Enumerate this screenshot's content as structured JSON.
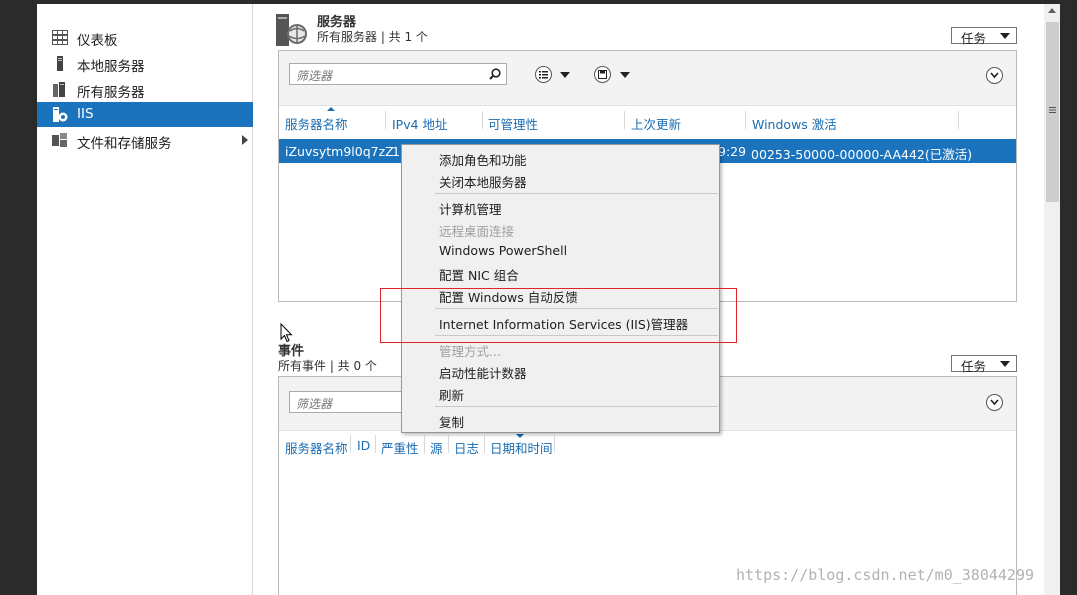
{
  "sidebar": {
    "items": [
      {
        "label": "仪表板",
        "icon": "dashboard-icon",
        "active": false
      },
      {
        "label": "本地服务器",
        "icon": "local-server-icon",
        "active": false
      },
      {
        "label": "所有服务器",
        "icon": "all-servers-icon",
        "active": false
      },
      {
        "label": "IIS",
        "icon": "iis-icon",
        "active": true
      },
      {
        "label": "文件和存储服务",
        "icon": "file-storage-icon",
        "active": false
      }
    ]
  },
  "servers": {
    "title": "服务器",
    "subtitle": "所有服务器 | 共 1 个",
    "tasks_label": "任务",
    "filter_placeholder": "筛选器",
    "columns": [
      "服务器名称",
      "IPv4 地址",
      "可管理性",
      "上次更新",
      "Windows 激活"
    ],
    "row": {
      "name": "iZuvsytm9l0q7zZ",
      "ipv4_fragment": "17",
      "last_update_fragment": "9:29",
      "activation": "00253-50000-00000-AA442(已激活)"
    }
  },
  "events": {
    "title": "事件",
    "subtitle": "所有事件 | 共 0 个",
    "tasks_label": "任务",
    "filter_placeholder": "筛选器",
    "columns": [
      "服务器名称",
      "ID",
      "严重性",
      "源",
      "日志",
      "日期和时间"
    ]
  },
  "context_menu": {
    "items": [
      {
        "label": "添加角色和功能",
        "enabled": true
      },
      {
        "label": "关闭本地服务器",
        "enabled": true
      },
      {
        "label": "计算机管理",
        "enabled": true
      },
      {
        "label": "远程桌面连接",
        "enabled": false
      },
      {
        "label": "Windows PowerShell",
        "enabled": true
      },
      {
        "label": "配置 NIC 组合",
        "enabled": true
      },
      {
        "label": "配置 Windows 自动反馈",
        "enabled": true
      },
      {
        "label": "Internet Information Services (IIS)管理器",
        "enabled": true
      },
      {
        "label": "管理方式...",
        "enabled": false
      },
      {
        "label": "启动性能计数器",
        "enabled": true
      },
      {
        "label": "刷新",
        "enabled": true
      },
      {
        "label": "复制",
        "enabled": true
      }
    ]
  },
  "colors": {
    "accent": "#1b73be",
    "highlight_box": "#e0242c",
    "column_header": "#1a6cb3"
  },
  "watermark": "https://blog.csdn.net/m0_38044299"
}
